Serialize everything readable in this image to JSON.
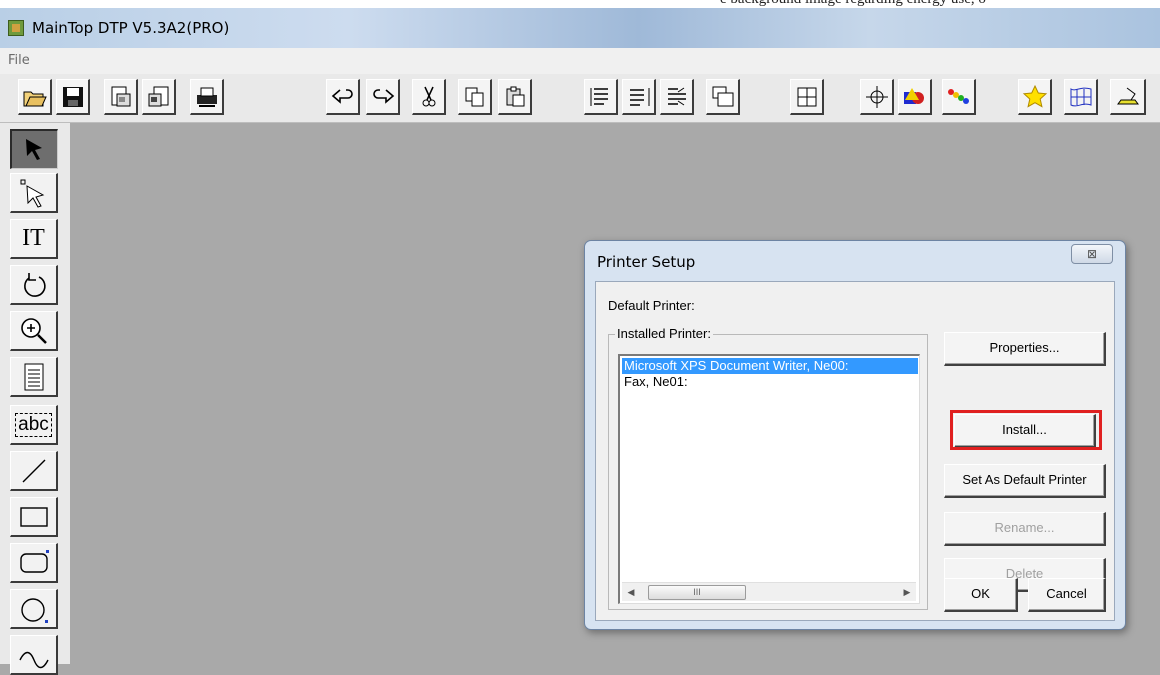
{
  "page_top_text": "e background image regarding energy use, o",
  "window": {
    "title": "MainTop DTP V5.3A2(PRO)"
  },
  "menubar": {
    "file": "File"
  },
  "toolbar": {
    "buttons": [
      "open",
      "save",
      "import",
      "export",
      "print",
      "undo",
      "redo",
      "cut",
      "copy",
      "paste",
      "text-flow-1",
      "text-flow-2",
      "text-flow-3",
      "group",
      "ungroup",
      "center",
      "color-shapes",
      "gradient",
      "star",
      "mesh",
      "stamp"
    ]
  },
  "palette": {
    "tools": [
      "select",
      "node-select",
      "text",
      "rotate",
      "zoom",
      "document",
      "text-box",
      "line",
      "rectangle",
      "rounded-rectangle",
      "ellipse",
      "curve"
    ],
    "text_label": "IT",
    "abc_label": "abc"
  },
  "dialog": {
    "title": "Printer Setup",
    "close_label": "⊠",
    "default_printer_label": "Default Printer:",
    "installed_printer_label": "Installed Printer:",
    "printers": [
      {
        "name": "Microsoft XPS Document Writer, Ne00:",
        "selected": true
      },
      {
        "name": "Fax, Ne01:",
        "selected": false
      }
    ],
    "scroll_thumb": "III",
    "buttons": {
      "properties": "Properties...",
      "install": "Install...",
      "set_default": "Set As Default Printer",
      "rename": "Rename...",
      "delete": "Delete",
      "ok": "OK",
      "cancel": "Cancel"
    }
  },
  "colors": {
    "selection": "#3399ff",
    "highlight": "#e02020",
    "workspace": "#a9a9a9"
  }
}
